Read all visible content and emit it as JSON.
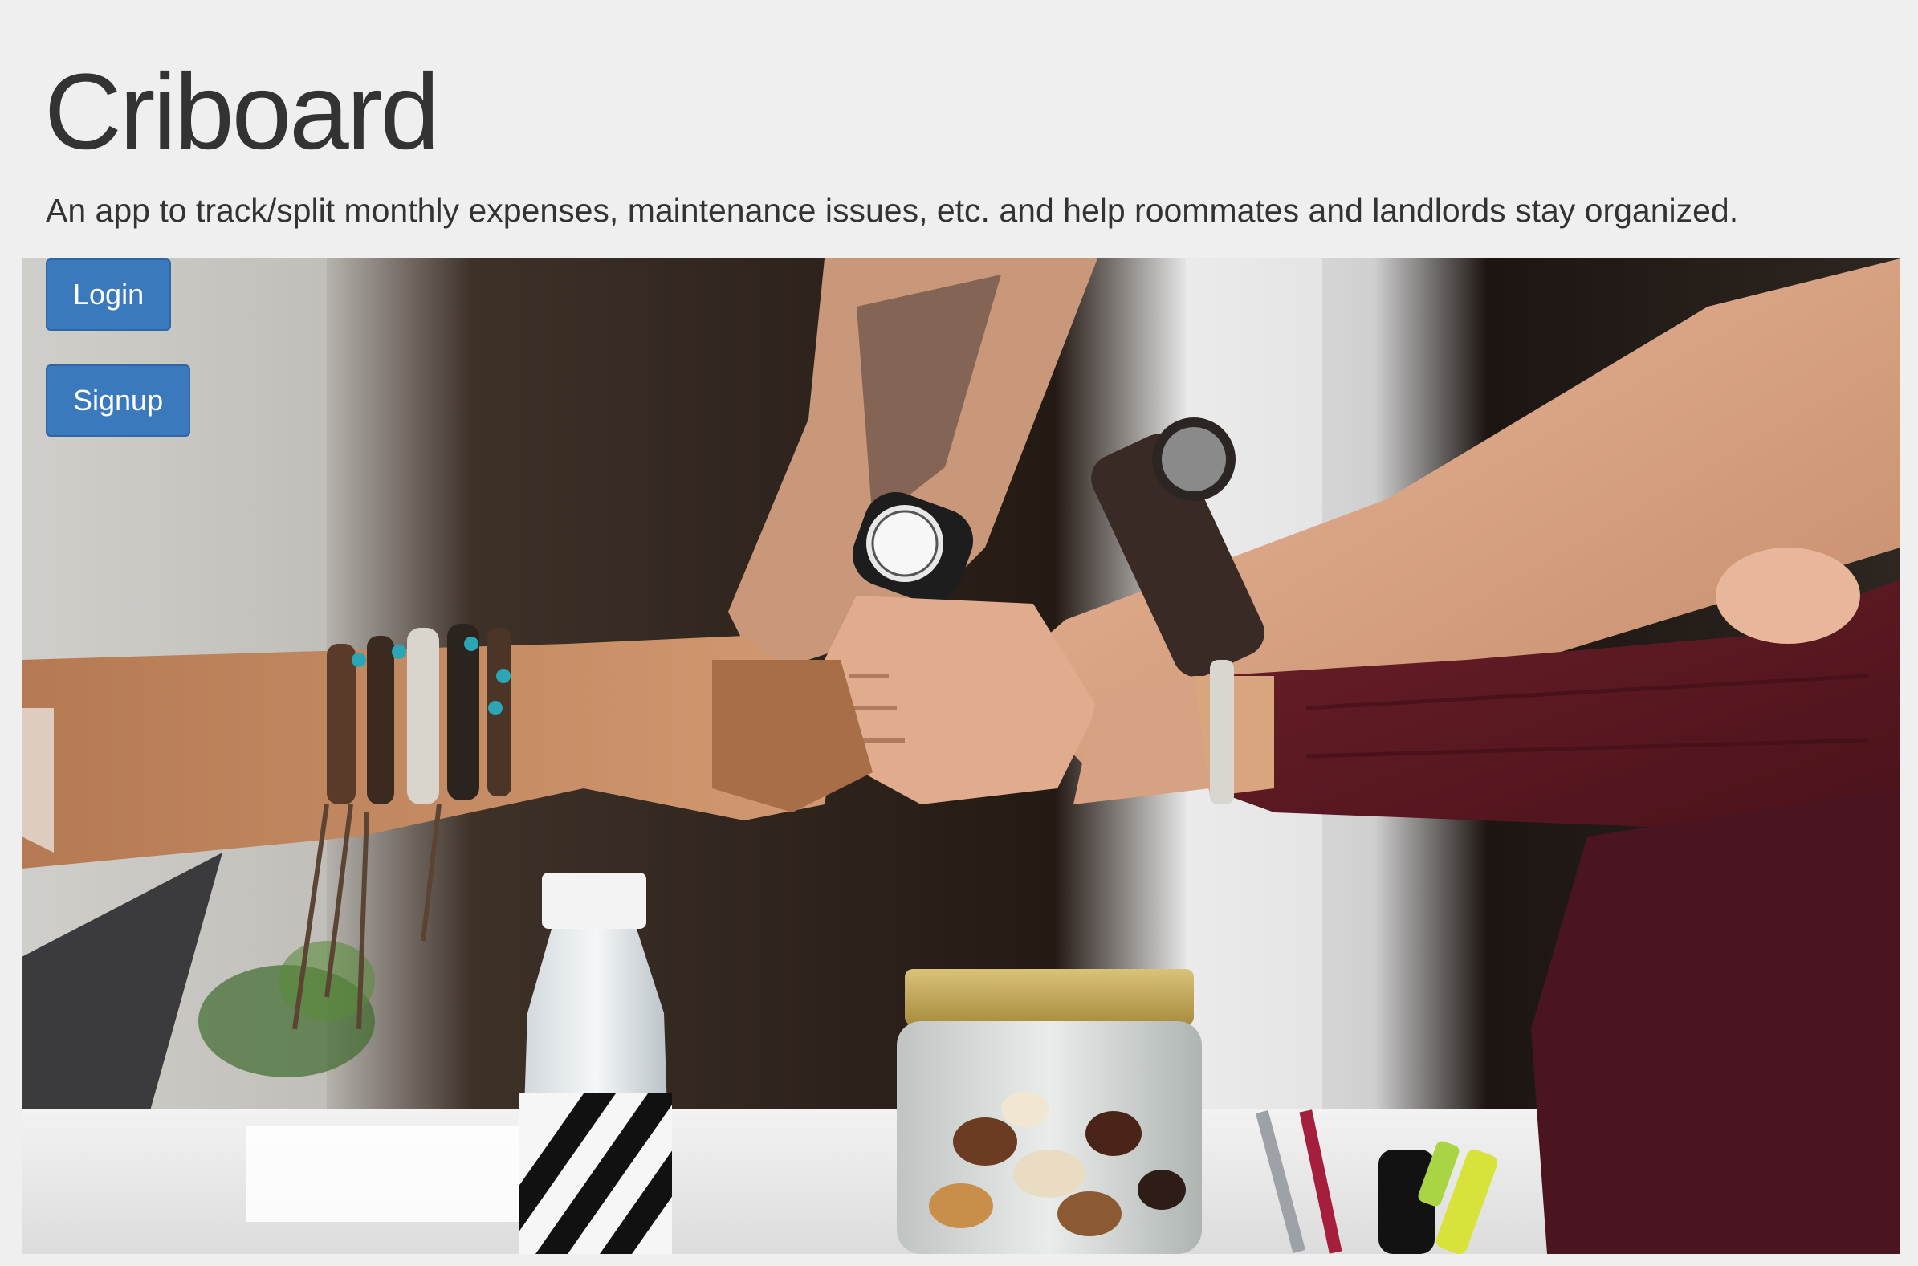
{
  "header": {
    "title": "Criboard",
    "subtitle": "An app to track/split monthly expenses, maintenance issues, etc. and help roommates and landlords stay organized."
  },
  "auth": {
    "login_label": "Login",
    "signup_label": "Signup"
  },
  "colors": {
    "page_background": "#efefef",
    "button_background": "#3a79bb",
    "text": "#333333"
  }
}
